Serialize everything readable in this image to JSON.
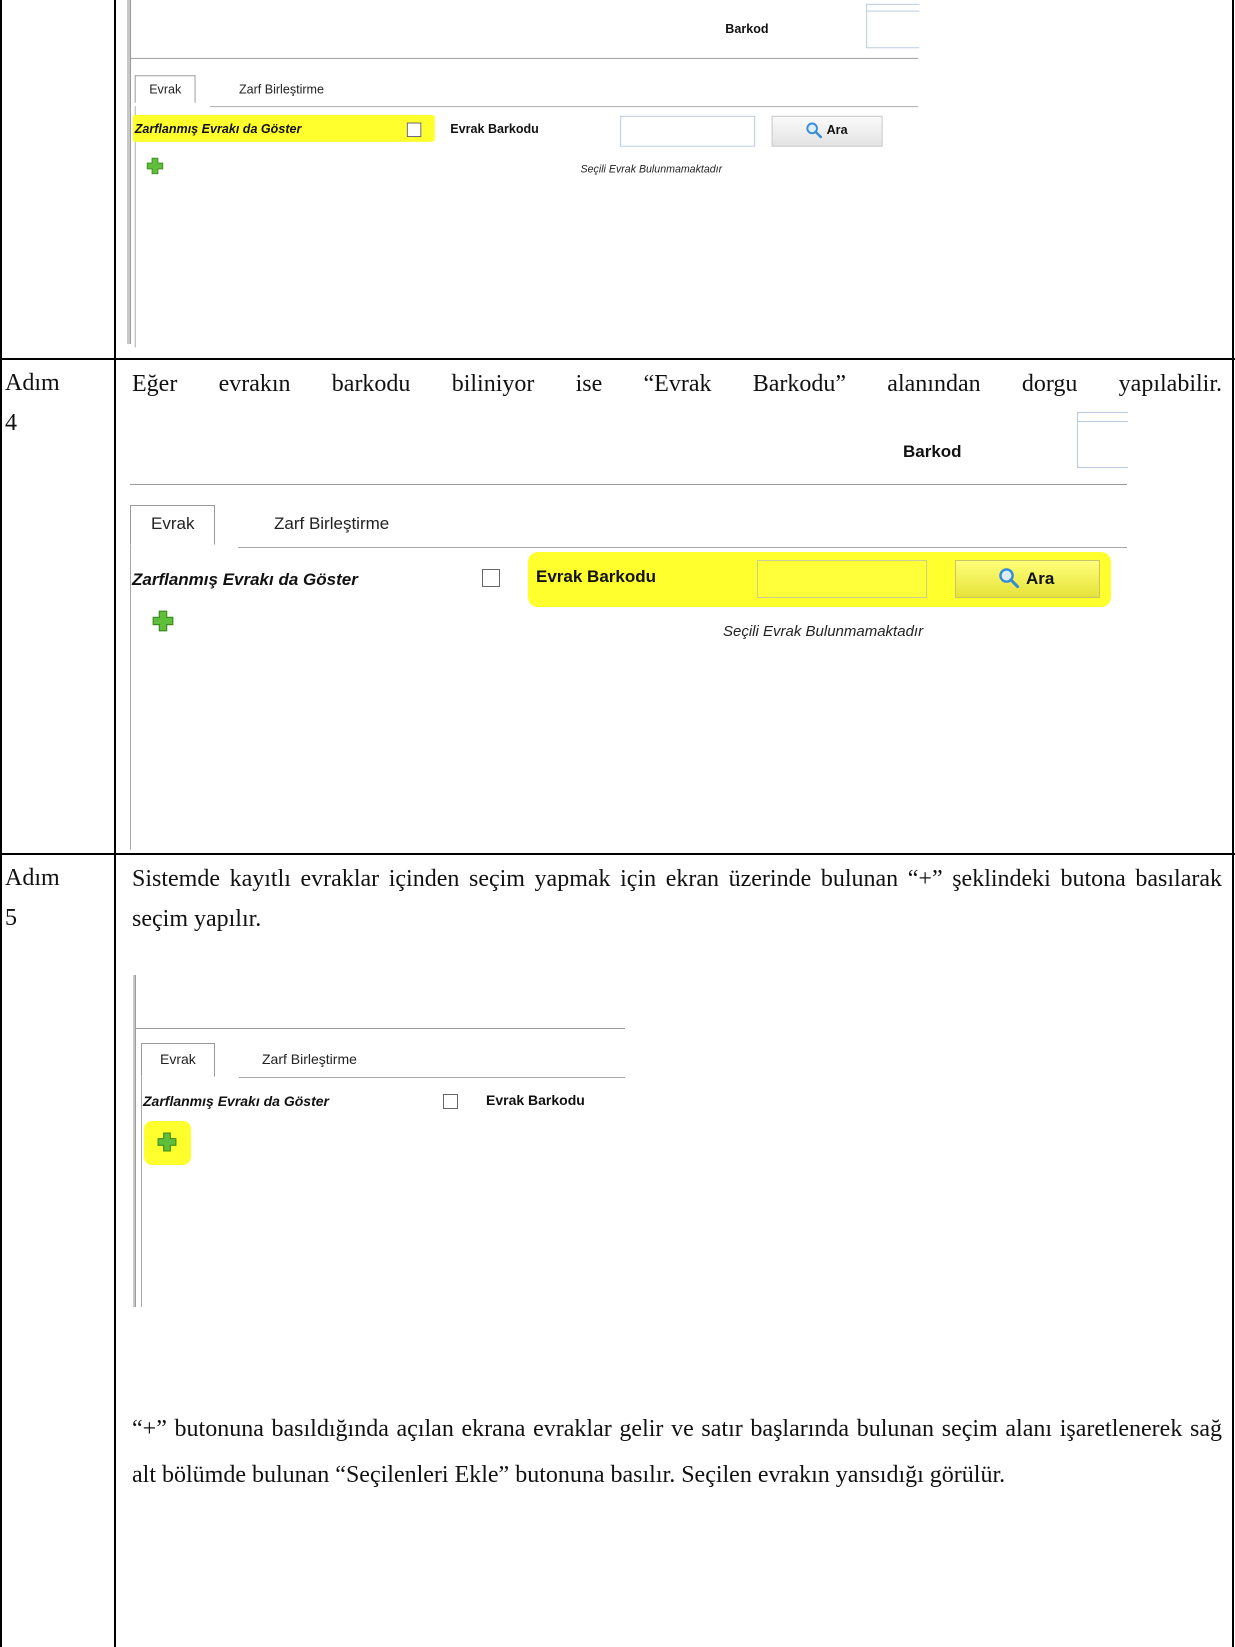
{
  "steps": [
    {
      "label_line1": "Adım",
      "label_line2": "4",
      "text": "Eğer evrakın barkodu biliniyor ise “Evrak Barkodu” alanından dorgu yapılabilir."
    },
    {
      "label_line1": "Adım",
      "label_line2": "5",
      "text": "Sistemde kayıtlı evraklar içinden seçim yapmak için ekran üzerinde bulunan “+” şeklindeki butona basılarak seçim yapılır.",
      "text_after": "“+” butonuna basıldığında açılan ekrana evraklar gelir ve satır başlarında bulunan seçim alanı işaretlenerek sağ alt bölümde bulunan “Seçilenleri Ekle” butonuna basılır. Seçilen evrakın yansıdığı görülür."
    }
  ],
  "ui": {
    "barcode_label": "Barkod",
    "tab_evrak": "Evrak",
    "tab_zarf": "Zarf Birleştirme",
    "show_enveloped_label": "Zarflanmış Evrakı da Göster",
    "barcode_field_label": "Evrak Barkodu",
    "search_button": "Ara",
    "empty_message": "Seçili Evrak Bulunmamaktadır",
    "search_icon": "magnifier-icon",
    "add_icon": "green-plus-icon",
    "highlight_color": "#ffff2d"
  }
}
